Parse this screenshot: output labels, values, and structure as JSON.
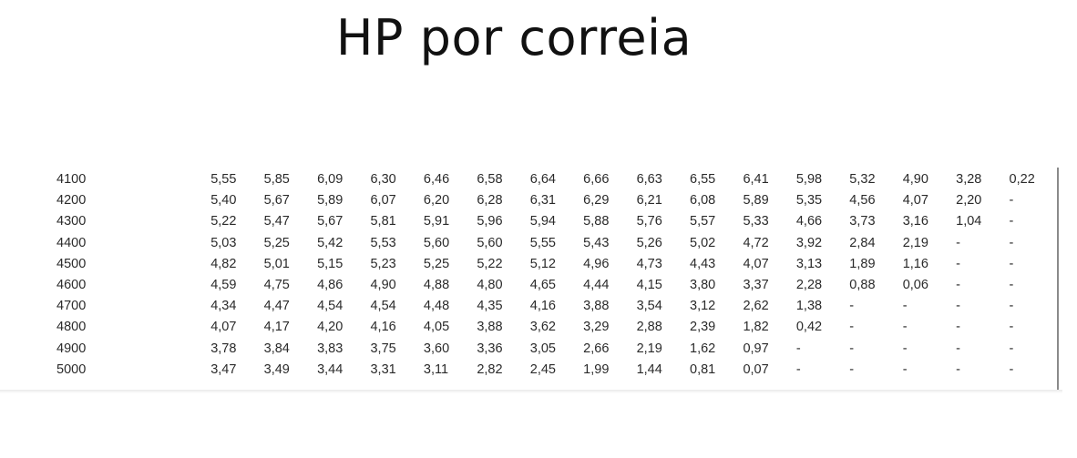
{
  "title": "HP por correia",
  "table": {
    "rows": [
      {
        "rpm": "4100",
        "values": [
          "5,55",
          "5,85",
          "6,09",
          "6,30",
          "6,46",
          "6,58",
          "6,64",
          "6,66",
          "6,63",
          "6,55",
          "6,41",
          "5,98",
          "5,32",
          "4,90",
          "3,28",
          "0,22"
        ]
      },
      {
        "rpm": "4200",
        "values": [
          "5,40",
          "5,67",
          "5,89",
          "6,07",
          "6,20",
          "6,28",
          "6,31",
          "6,29",
          "6,21",
          "6,08",
          "5,89",
          "5,35",
          "4,56",
          "4,07",
          "2,20",
          "-"
        ]
      },
      {
        "rpm": "4300",
        "values": [
          "5,22",
          "5,47",
          "5,67",
          "5,81",
          "5,91",
          "5,96",
          "5,94",
          "5,88",
          "5,76",
          "5,57",
          "5,33",
          "4,66",
          "3,73",
          "3,16",
          "1,04",
          "-"
        ]
      },
      {
        "rpm": "4400",
        "values": [
          "5,03",
          "5,25",
          "5,42",
          "5,53",
          "5,60",
          "5,60",
          "5,55",
          "5,43",
          "5,26",
          "5,02",
          "4,72",
          "3,92",
          "2,84",
          "2,19",
          "-",
          "-"
        ]
      },
      {
        "rpm": "4500",
        "values": [
          "4,82",
          "5,01",
          "5,15",
          "5,23",
          "5,25",
          "5,22",
          "5,12",
          "4,96",
          "4,73",
          "4,43",
          "4,07",
          "3,13",
          "1,89",
          "1,16",
          "-",
          "-"
        ]
      },
      {
        "rpm": "4600",
        "values": [
          "4,59",
          "4,75",
          "4,86",
          "4,90",
          "4,88",
          "4,80",
          "4,65",
          "4,44",
          "4,15",
          "3,80",
          "3,37",
          "2,28",
          "0,88",
          "0,06",
          "-",
          "-"
        ]
      },
      {
        "rpm": "4700",
        "values": [
          "4,34",
          "4,47",
          "4,54",
          "4,54",
          "4,48",
          "4,35",
          "4,16",
          "3,88",
          "3,54",
          "3,12",
          "2,62",
          "1,38",
          "-",
          "-",
          "-",
          "-"
        ]
      },
      {
        "rpm": "4800",
        "values": [
          "4,07",
          "4,17",
          "4,20",
          "4,16",
          "4,05",
          "3,88",
          "3,62",
          "3,29",
          "2,88",
          "2,39",
          "1,82",
          "0,42",
          "-",
          "-",
          "-",
          "-"
        ]
      },
      {
        "rpm": "4900",
        "values": [
          "3,78",
          "3,84",
          "3,83",
          "3,75",
          "3,60",
          "3,36",
          "3,05",
          "2,66",
          "2,19",
          "1,62",
          "0,97",
          "-",
          "-",
          "-",
          "-",
          "-"
        ]
      },
      {
        "rpm": "5000",
        "values": [
          "3,47",
          "3,49",
          "3,44",
          "3,31",
          "3,11",
          "2,82",
          "2,45",
          "1,99",
          "1,44",
          "0,81",
          "0,07",
          "-",
          "-",
          "-",
          "-",
          "-"
        ]
      }
    ]
  }
}
